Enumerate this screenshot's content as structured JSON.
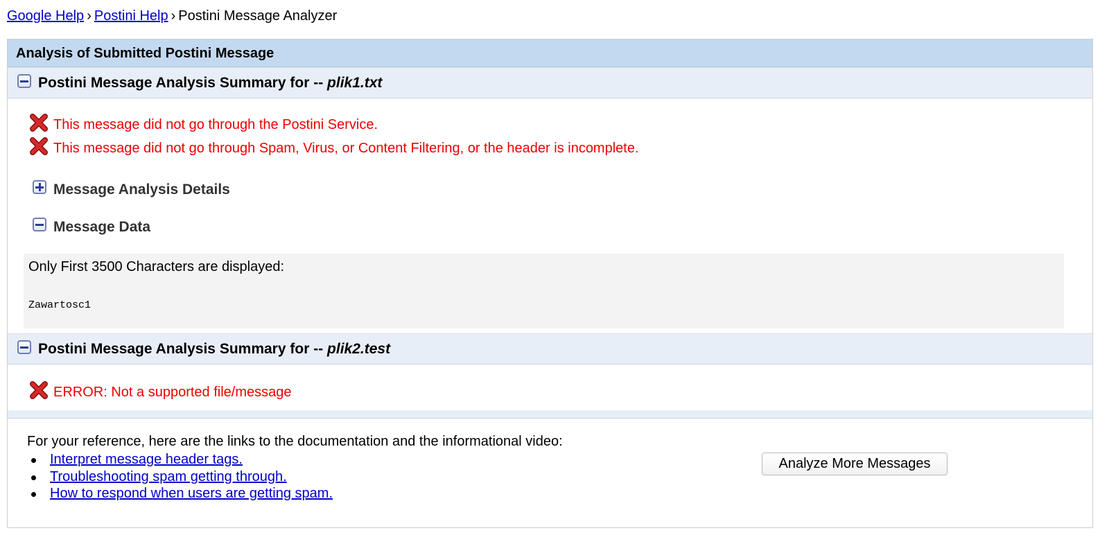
{
  "breadcrumb": {
    "link1": "Google Help",
    "sep": "›",
    "link2": "Postini Help",
    "current": "Postini Message Analyzer"
  },
  "panel": {
    "title": "Analysis of Submitted Postini Message"
  },
  "summaries": [
    {
      "header_prefix": "Postini Message Analysis Summary for -- ",
      "filename": "plik1.txt",
      "errors": [
        "This message did not go through the Postini Service.",
        "This message did not go through Spam, Virus, or Content Filtering, or the header is incomplete."
      ],
      "details_label": "Message Analysis Details",
      "data_label": "Message Data",
      "data_note": "Only First 3500 Characters are displayed:",
      "data_content": "Zawartosc1"
    },
    {
      "header_prefix": "Postini Message Analysis Summary for -- ",
      "filename": "plik2.test",
      "errors": [
        "ERROR: Not a supported file/message"
      ]
    }
  ],
  "reference": {
    "intro": "For your reference, here are the links to the documentation and the informational video:",
    "links": [
      "Interpret message header tags.",
      "Troubleshooting spam getting through.",
      "How to respond when users are getting spam."
    ]
  },
  "analyze_button": "Analyze More Messages",
  "colors": {
    "error_text": "#ee0000",
    "panel_title_bg": "#c3d9ef",
    "summary_header_bg": "#e8eef7",
    "link": "#0000cc"
  },
  "icons": {
    "collapse": "minus-box-icon",
    "expand": "plus-box-icon",
    "error": "red-x-icon"
  }
}
